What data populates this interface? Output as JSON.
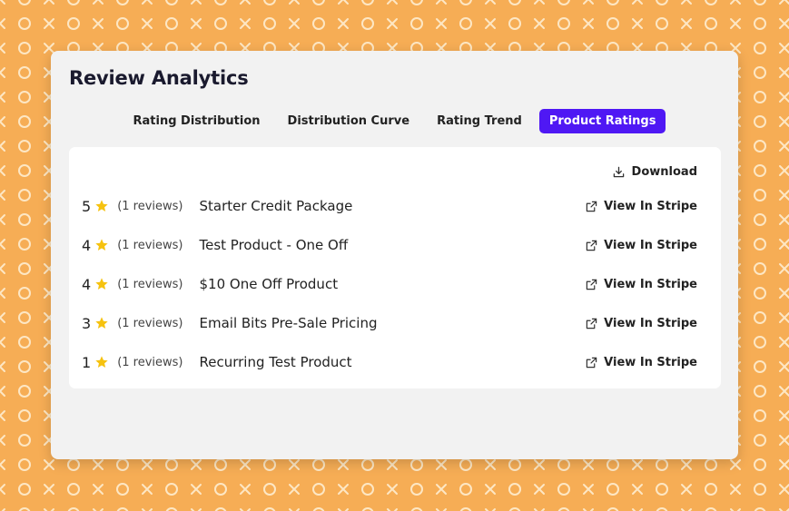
{
  "page": {
    "title": "Review Analytics"
  },
  "tabs": [
    {
      "label": "Rating Distribution",
      "active": false
    },
    {
      "label": "Distribution Curve",
      "active": false
    },
    {
      "label": "Rating Trend",
      "active": false
    },
    {
      "label": "Product Ratings",
      "active": true
    }
  ],
  "toolbar": {
    "download_label": "Download",
    "download_icon": "download-icon"
  },
  "products": [
    {
      "rating": "5",
      "reviews": "(1 reviews)",
      "name": "Starter Credit Package",
      "link_label": "View In Stripe"
    },
    {
      "rating": "4",
      "reviews": "(1 reviews)",
      "name": "Test Product - One Off",
      "link_label": "View In Stripe"
    },
    {
      "rating": "4",
      "reviews": "(1 reviews)",
      "name": "$10 One Off Product",
      "link_label": "View In Stripe"
    },
    {
      "rating": "3",
      "reviews": "(1 reviews)",
      "name": "Email Bits Pre-Sale Pricing",
      "link_label": "View In Stripe"
    },
    {
      "rating": "1",
      "reviews": "(1 reviews)",
      "name": "Recurring Test Product",
      "link_label": "View In Stripe"
    }
  ],
  "colors": {
    "background": "#f6ad55",
    "pattern": "#fde7c4",
    "accent": "#4f18f4",
    "star": "#f6c20f"
  }
}
